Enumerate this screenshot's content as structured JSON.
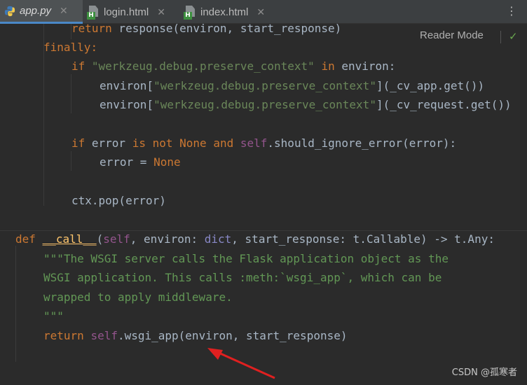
{
  "tabs": [
    {
      "label": "app.py",
      "active": true,
      "icon": "python-file-icon"
    },
    {
      "label": "login.html",
      "active": false,
      "icon": "html-file-icon"
    },
    {
      "label": "index.html",
      "active": false,
      "icon": "html-file-icon"
    }
  ],
  "tab_close_glyph": "✕",
  "more_glyph": "⋮",
  "reader_mode": "Reader Mode",
  "watermark": "CSDN @孤寒者",
  "code": {
    "l1": [
      "return",
      " response(environ, start_response)"
    ],
    "l2": [
      "finally",
      ":"
    ],
    "l3": [
      "if",
      " ",
      "\"werkzeug.debug.preserve_context\"",
      " ",
      "in",
      " environ:"
    ],
    "l4": [
      "environ[",
      "\"werkzeug.debug.preserve_context\"",
      "](_cv_app.get())"
    ],
    "l5": [
      "environ[",
      "\"werkzeug.debug.preserve_context\"",
      "](_cv_request.get())"
    ],
    "l6": [
      "if",
      " error ",
      "is",
      " ",
      "not",
      " ",
      "None",
      " ",
      "and",
      " ",
      "self",
      ".should_ignore_error(error):"
    ],
    "l7": [
      "error = ",
      "None"
    ],
    "l8": [
      "ctx.pop(error)"
    ],
    "l9": [
      "def",
      " ",
      "__call__",
      "(",
      "self",
      ", environ: ",
      "dict",
      ", start_response: t.Callable) -> t.Any:"
    ],
    "l10": "\"\"\"The WSGI server calls the Flask application object as the",
    "l11": "WSGI application. This calls :meth:`wsgi_app`, which can be",
    "l12": "wrapped to apply middleware.",
    "l13": "\"\"\"",
    "l14": [
      "return",
      " ",
      "self",
      ".wsgi_app(environ, start_response)"
    ]
  }
}
